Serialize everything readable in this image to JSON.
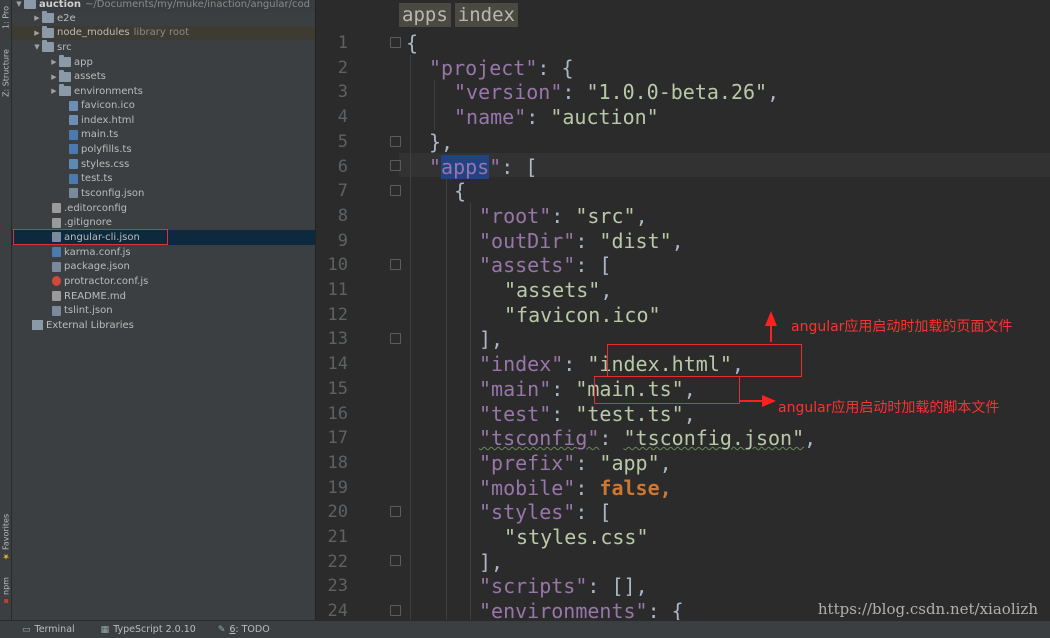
{
  "tool_strip": {
    "project_tab": "1: Pro",
    "structure_tab": "Z: Structure",
    "favorites_tab": "Favorites",
    "npm_tab": "npm"
  },
  "project_tree": {
    "root_name": "auction",
    "root_path": "~/Documents/my/muke/inaction/angular/cod",
    "items": [
      {
        "label": "e2e",
        "type": "folder",
        "extra": ""
      },
      {
        "label": "node_modules",
        "type": "folder",
        "extra": "library root"
      },
      {
        "label": "src",
        "type": "folder",
        "extra": ""
      },
      {
        "label": "app",
        "type": "folder",
        "extra": ""
      },
      {
        "label": "assets",
        "type": "folder",
        "extra": ""
      },
      {
        "label": "environments",
        "type": "folder",
        "extra": ""
      },
      {
        "label": "favicon.ico",
        "type": "file",
        "extra": ""
      },
      {
        "label": "index.html",
        "type": "file",
        "extra": ""
      },
      {
        "label": "main.ts",
        "type": "file",
        "extra": ""
      },
      {
        "label": "polyfills.ts",
        "type": "file",
        "extra": ""
      },
      {
        "label": "styles.css",
        "type": "file",
        "extra": ""
      },
      {
        "label": "test.ts",
        "type": "file",
        "extra": ""
      },
      {
        "label": "tsconfig.json",
        "type": "file",
        "extra": ""
      },
      {
        "label": ".editorconfig",
        "type": "file",
        "extra": ""
      },
      {
        "label": ".gitignore",
        "type": "file",
        "extra": ""
      },
      {
        "label": "angular-cli.json",
        "type": "file",
        "extra": ""
      },
      {
        "label": "karma.conf.js",
        "type": "file",
        "extra": ""
      },
      {
        "label": "package.json",
        "type": "file",
        "extra": ""
      },
      {
        "label": "protractor.conf.js",
        "type": "file",
        "extra": ""
      },
      {
        "label": "README.md",
        "type": "file",
        "extra": ""
      },
      {
        "label": "tslint.json",
        "type": "file",
        "extra": ""
      },
      {
        "label": "External Libraries",
        "type": "library",
        "extra": ""
      }
    ]
  },
  "editor": {
    "breadcrumbs": [
      "apps",
      "index"
    ],
    "line_numbers": [
      "1",
      "2",
      "3",
      "4",
      "5",
      "6",
      "7",
      "8",
      "9",
      "10",
      "11",
      "12",
      "13",
      "14",
      "15",
      "16",
      "17",
      "18",
      "19",
      "20",
      "21",
      "22",
      "23",
      "24"
    ]
  },
  "code": {
    "l1_brace": "{",
    "project_key": "\"project\"",
    "version_key": "\"version\"",
    "version_val": "\"1.0.0-beta.26\"",
    "name_key": "\"name\"",
    "name_val": "\"auction\"",
    "close_obj": "},",
    "apps_q1": "\"",
    "apps_sel": "apps",
    "apps_q2": "\"",
    "open_obj": "{",
    "root_key": "\"root\"",
    "root_val": "\"src\"",
    "outdir_key": "\"outDir\"",
    "outdir_val": "\"dist\"",
    "assets_key": "\"assets\"",
    "assets_item1": "\"assets\"",
    "assets_item2": "\"favicon.ico\"",
    "close_arr": "],",
    "index_key": "\"index\"",
    "index_val": "\"index.html\"",
    "main_key": "\"main\"",
    "main_val": "\"main.ts\"",
    "test_key": "\"test\"",
    "test_val": "\"test.ts\"",
    "tsconfig_key": "\"tsconfig\"",
    "tsconfig_val": "\"tsconfig.json\"",
    "prefix_key": "\"prefix\"",
    "prefix_val": "\"app\"",
    "mobile_key": "\"mobile\"",
    "mobile_val": "false",
    "styles_key": "\"styles\"",
    "styles_item": "\"styles.css\"",
    "scripts_key": "\"scripts\"",
    "scripts_val": "[]",
    "env_key": "\"environments\""
  },
  "annotations": {
    "index_note": "angular应用启动时加载的页面文件",
    "main_note": "angular应用启动时加载的脚本文件"
  },
  "watermark": "https://blog.csdn.net/xiaolizh",
  "statusbar": {
    "terminal": "Terminal",
    "typescript": "TypeScript 2.0.10",
    "todo_num": "6",
    "todo_label": ": TODO"
  },
  "colors": {
    "keys": "#9876aa",
    "strings": "#6a8759",
    "keyword": "#cc7832",
    "annotation": "#ff3030"
  }
}
